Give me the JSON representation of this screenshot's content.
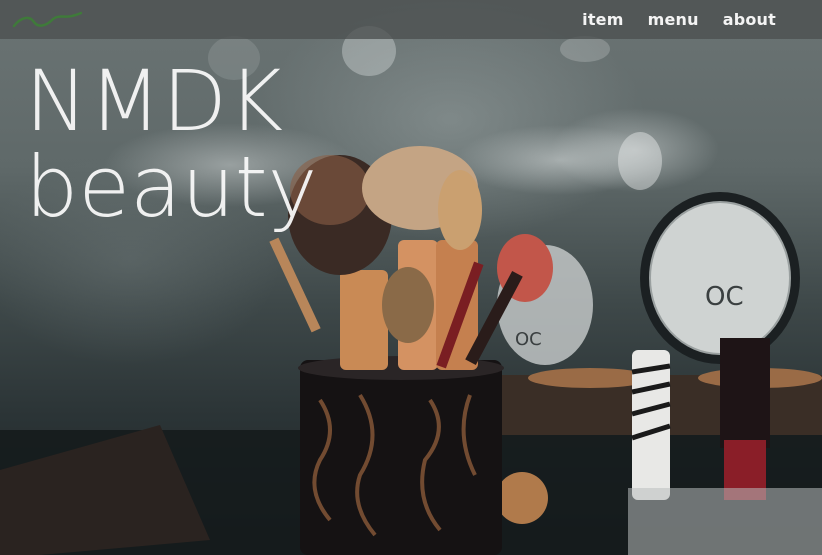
{
  "nav": {
    "items": [
      {
        "label": "item"
      },
      {
        "label": "menu"
      },
      {
        "label": "about"
      }
    ]
  },
  "hero": {
    "title_line1": "NMDK",
    "title_line2": "beauty"
  },
  "colors": {
    "navbar_bg": "#4b5050",
    "nav_text": "#f4f4f4",
    "logo_accent": "#3f7a3a",
    "title_text": "#f8f8f8"
  },
  "icons": {
    "logo": "brand-logo-icon"
  }
}
